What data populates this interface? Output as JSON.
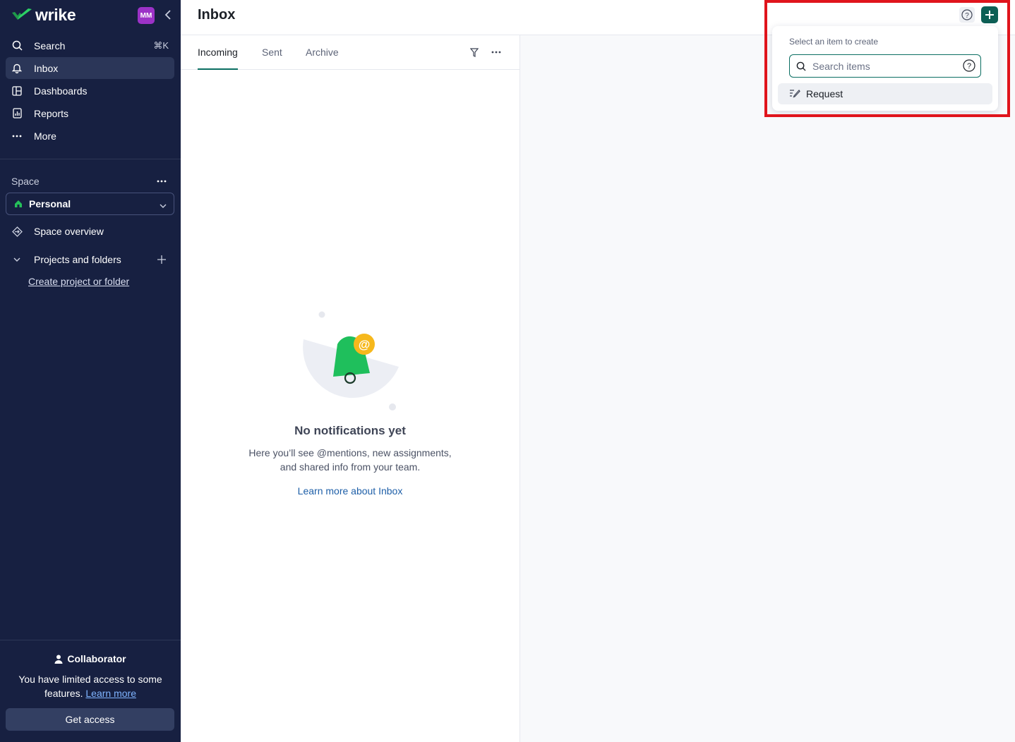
{
  "app": {
    "logo_text": "wrike",
    "avatar_initials": "MM"
  },
  "sidebar": {
    "nav": [
      {
        "label": "Search",
        "shortcut": "⌘K",
        "icon": "search-icon"
      },
      {
        "label": "Inbox",
        "icon": "bell-icon",
        "active": true
      },
      {
        "label": "Dashboards",
        "icon": "dashboard-icon"
      },
      {
        "label": "Reports",
        "icon": "report-icon"
      },
      {
        "label": "More",
        "icon": "more-dots-icon"
      }
    ],
    "space_label": "Space",
    "space_selected": "Personal",
    "space_overview": "Space overview",
    "projects_label": "Projects and folders",
    "create_link": "Create project or folder",
    "collaborator": {
      "title": "Collaborator",
      "text": "You have limited access to some features.",
      "link": "Learn more",
      "button": "Get access"
    }
  },
  "header": {
    "title": "Inbox"
  },
  "inbox": {
    "tabs": [
      "Incoming",
      "Sent",
      "Archive"
    ],
    "active_tab": "Incoming",
    "empty": {
      "title": "No notifications yet",
      "line1": "Here you’ll see @mentions, new assignments,",
      "line2": "and shared info from your team.",
      "link": "Learn more about Inbox"
    }
  },
  "create_menu": {
    "label": "Select an item to create",
    "search_placeholder": "Search items",
    "items": [
      {
        "label": "Request",
        "icon": "request-icon"
      }
    ]
  },
  "colors": {
    "sidebar_bg": "#172041",
    "accent": "#0d5f55",
    "brand_green": "#25c05a",
    "highlight": "#e0141c"
  }
}
